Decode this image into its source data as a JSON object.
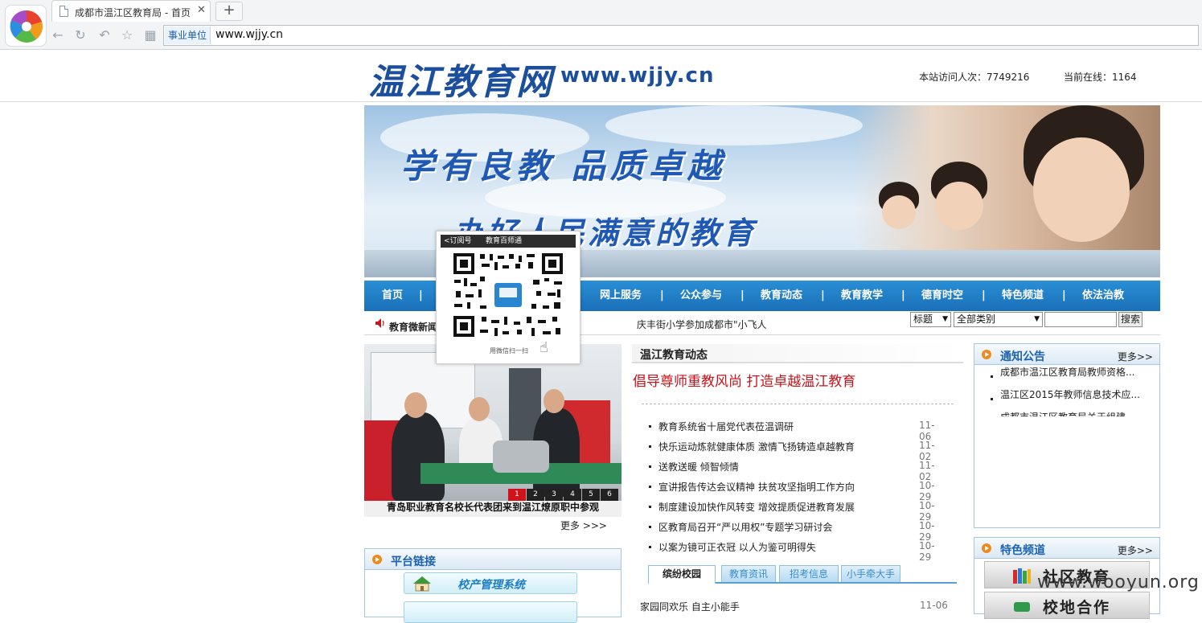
{
  "browser": {
    "tab_title": "成都市温江区教育局 - 首页",
    "tab_close": "✕",
    "new_tab": "+",
    "address_badge": "事业单位",
    "url": "www.wjjy.cn"
  },
  "header": {
    "logo_text": "温江教育网",
    "site_url": "www.wjjy.cn",
    "visits": "本站访问人次：7749216",
    "online": "当前在线：1164"
  },
  "banner": {
    "slogan1": "学有良教   品质卓越",
    "slogan2": "办好人民满意的教育"
  },
  "nav": {
    "items": [
      "首页",
      "网上服务",
      "公众参与",
      "教育动态",
      "教育教学",
      "德育时空",
      "特色频道",
      "依法治教"
    ],
    "separator": "|"
  },
  "ticker": {
    "label": "教育微新闻",
    "text": "庆丰街小学参加成都市\"小飞人",
    "search_scope": "标题",
    "search_category": "全部类别",
    "search_button": "搜索"
  },
  "qr_popup": {
    "back": "<订阅号",
    "title": "教育百师通",
    "caption": "用微信扫一扫"
  },
  "photo_news": {
    "caption": "青岛职业教育名校长代表团来到温江燎原职中参观",
    "slides": [
      "1",
      "2",
      "3",
      "4",
      "5",
      "6"
    ],
    "active_slide": "1",
    "more": "更多 >>>"
  },
  "platform_links": {
    "title": "平台链接",
    "items": [
      "校产管理系统"
    ]
  },
  "center_news": {
    "section_title": "温江教育动态",
    "headline": "倡导尊师重教风尚 打造卓越温江教育",
    "items": [
      {
        "title": "教育系统省十届党代表莅温调研",
        "date": "11-06"
      },
      {
        "title": "快乐运动炼就健康体质 激情飞扬铸造卓越教育",
        "date": "11-02"
      },
      {
        "title": "送教送暖 倾智倾情",
        "date": "11-02"
      },
      {
        "title": "宣讲报告传达会议精神 扶贫攻坚指明工作方向",
        "date": "10-29"
      },
      {
        "title": "制度建设加快作风转变 增效提质促进教育发展",
        "date": "10-29"
      },
      {
        "title": "区教育局召开“严以用权”专题学习研讨会",
        "date": "10-29"
      },
      {
        "title": "以案为镜可正衣冠 以人为鉴可明得失",
        "date": "10-29"
      }
    ],
    "sub_tabs": [
      "缤纷校园",
      "教育资讯",
      "招考信息",
      "小手牵大手"
    ],
    "active_sub_tab": "缤纷校园",
    "sub_item": {
      "title": "家园同欢乐 自主小能手",
      "date": "11-06"
    }
  },
  "notices": {
    "title": "通知公告",
    "more": "更多>>",
    "items": [
      "成都市温江区教育局教师资格...",
      "温江区2015年教师信息技术应...",
      "成都市温江区教育局关于组建..."
    ]
  },
  "features": {
    "title": "特色频道",
    "more": "更多>>",
    "items": [
      "社区教育",
      "校地合作"
    ]
  },
  "watermark": "www.wooyun.org",
  "colors": {
    "nav_blue": "#1a6fb8",
    "logo_blue": "#1b4f9c",
    "headline_red": "#c4161c",
    "accent_orange": "#f08a1c"
  }
}
